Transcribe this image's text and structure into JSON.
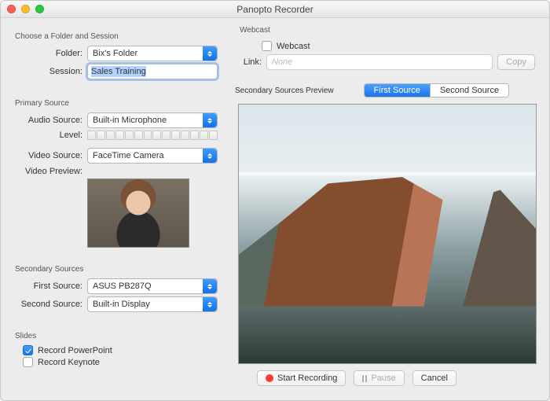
{
  "window": {
    "title": "Panopto Recorder"
  },
  "folder_session": {
    "group_label": "Choose a Folder and Session",
    "folder_label": "Folder:",
    "folder_value": "Bix's Folder",
    "session_label": "Session:",
    "session_value": "Sales Training"
  },
  "primary": {
    "group_label": "Primary Source",
    "audio_label": "Audio Source:",
    "audio_value": "Built-in Microphone",
    "level_label": "Level:",
    "video_label": "Video Source:",
    "video_value": "FaceTime Camera",
    "preview_label": "Video Preview:"
  },
  "secondary": {
    "group_label": "Secondary Sources",
    "first_label": "First Source:",
    "first_value": "ASUS PB287Q",
    "second_label": "Second Source:",
    "second_value": "Built-in Display"
  },
  "slides": {
    "group_label": "Slides",
    "record_ppt_label": "Record PowerPoint",
    "record_ppt_checked": true,
    "record_keynote_label": "Record Keynote",
    "record_keynote_checked": false
  },
  "webcast": {
    "group_label": "Webcast",
    "webcast_label": "Webcast",
    "webcast_checked": false,
    "link_label": "Link:",
    "link_placeholder": "None",
    "copy_label": "Copy"
  },
  "preview": {
    "group_label": "Secondary Sources Preview",
    "tab_first": "First Source",
    "tab_second": "Second Source"
  },
  "buttons": {
    "start": "Start Recording",
    "pause": "Pause",
    "cancel": "Cancel"
  }
}
